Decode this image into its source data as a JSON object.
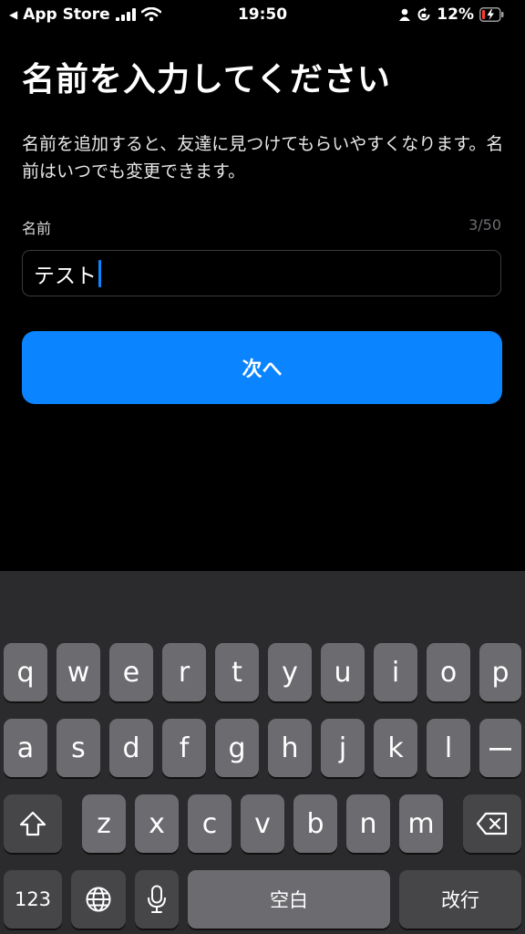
{
  "status_bar": {
    "back_app": "App Store",
    "time": "19:50",
    "battery_percent": "12%",
    "battery_color": "#ff3b30"
  },
  "page": {
    "title": "名前を入力してください",
    "description": "名前を追加すると、友達に見つけてもらいやすくなります。名前はいつでも変更できます。",
    "field_label": "名前",
    "char_count": "3/50",
    "name_value": "テスト",
    "next_label": "次へ",
    "accent_color": "#0a84ff"
  },
  "keyboard": {
    "row1": [
      "q",
      "w",
      "e",
      "r",
      "t",
      "y",
      "u",
      "i",
      "o",
      "p"
    ],
    "row2": [
      "a",
      "s",
      "d",
      "f",
      "g",
      "h",
      "j",
      "k",
      "l",
      "ー"
    ],
    "row3": [
      "z",
      "x",
      "c",
      "v",
      "b",
      "n",
      "m"
    ],
    "numbers_label": "123",
    "space_label": "空白",
    "return_label": "改行",
    "icons": [
      "shift-icon",
      "delete-icon",
      "globe-icon",
      "microphone-icon"
    ]
  }
}
